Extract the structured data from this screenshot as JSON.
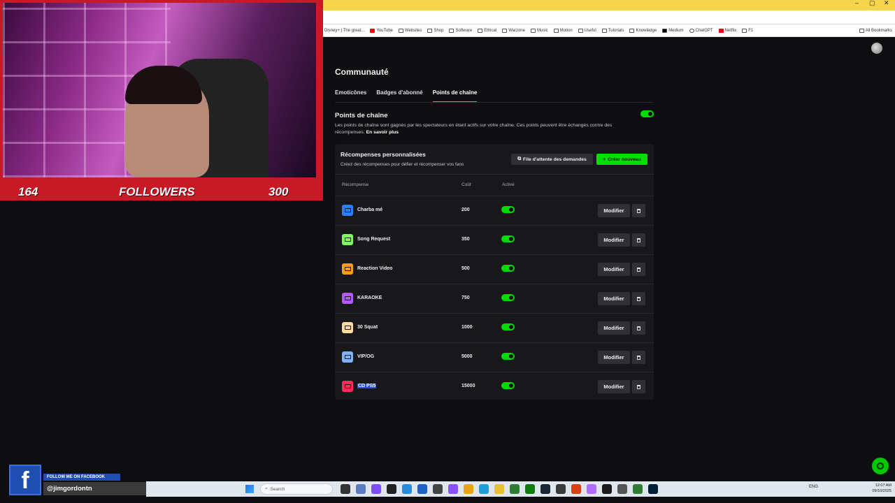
{
  "overlay": {
    "count_left": "164",
    "followers_label": "FOLLOWERS",
    "count_right": "300"
  },
  "bookmarks": [
    "",
    "Disney+ | The great...",
    "YouTube",
    "Websites",
    "Shop",
    "Software",
    "Ethical",
    "Warzone",
    "Music",
    "Motion",
    "Useful",
    "Tutorials",
    "Knowledge",
    "Medium",
    "ChatGPT",
    "Netflix",
    "F1",
    "All Bookmarks"
  ],
  "page": {
    "title": "Communauté",
    "tabs": [
      {
        "label": "Emoticônes"
      },
      {
        "label": "Badges d'abonné"
      },
      {
        "label": "Points de chaîne"
      }
    ],
    "section_title": "Points de chaîne",
    "section_desc": "Les points de chaîne sont gagnés par les spectateurs en étant actifs sur votre chaîne. Ces points peuvent être échangés contre des récompenses.",
    "learn_more": "En savoir plus",
    "panel_title": "Récompenses personnalisées",
    "panel_subtitle": "Créez des récompenses pour défier et récompenser vos fans",
    "queue_button": "File d'attente des demandes",
    "new_button": "Créer nouveau",
    "columns": {
      "reward": "Récompense",
      "cost": "Coût",
      "active": "Activé"
    },
    "modify_label": "Modifier",
    "rewards": [
      {
        "name": "Charba mé",
        "cost": "200",
        "color": "#2a7fff"
      },
      {
        "name": "Song Request",
        "cost": "350",
        "color": "#7dff5a"
      },
      {
        "name": "Reaction Video",
        "cost": "500",
        "color": "#ff9c1a"
      },
      {
        "name": "KARAOKE",
        "cost": "750",
        "color": "#b25cff"
      },
      {
        "name": "30 Squat",
        "cost": "1000",
        "color": "#ffd9a0"
      },
      {
        "name": "VIP/OG",
        "cost": "5000",
        "color": "#7fb3ff"
      },
      {
        "name": "CD PS5",
        "cost": "15000",
        "color": "#ff2b5a"
      }
    ]
  },
  "facebook": {
    "follow_text": "FOLLOW ME ON FACEBOOK",
    "handle": "@jimgordontn"
  },
  "taskbar": {
    "search_placeholder": "Search",
    "lang": "ENG",
    "time": "12:07 AM",
    "date": "09/10/2025"
  }
}
